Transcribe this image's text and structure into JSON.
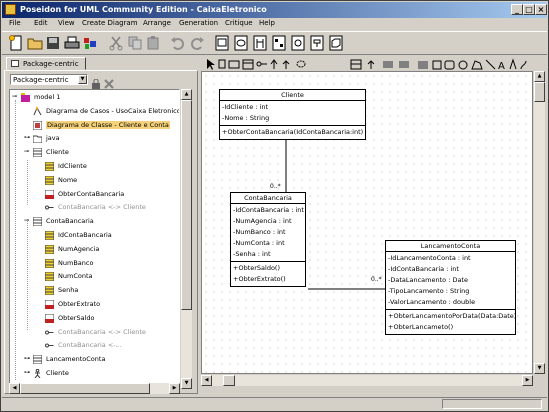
{
  "window": {
    "title": "Poseidon for UML Community Edition - CaixaEletronico"
  },
  "menu": [
    "File",
    "Edit",
    "View",
    "Create Diagram",
    "Arrange",
    "Generation",
    "Critique",
    "Help"
  ],
  "left_panel": {
    "tab_label": "Package-centric",
    "combo_value": "Package-centric",
    "tree": [
      {
        "label": "model 1",
        "icon": "package-icon",
        "level": 0,
        "expanded": true
      },
      {
        "label": "Diagrama de Casos - UsoCaixa Eletronico",
        "icon": "usecase-diagram-icon",
        "level": 1
      },
      {
        "label": "Diagrama de Classe - Cliente e Conta",
        "icon": "class-diagram-icon",
        "level": 1,
        "selected": true
      },
      {
        "label": "java",
        "icon": "folder-icon",
        "level": 1,
        "expanded": false
      },
      {
        "label": "Cliente",
        "icon": "class-icon",
        "level": 1,
        "expanded": true
      },
      {
        "label": "IdCliente",
        "icon": "attribute-icon",
        "level": 2
      },
      {
        "label": "Nome",
        "icon": "attribute-icon",
        "level": 2
      },
      {
        "label": "ObterContaBancaria",
        "icon": "operation-icon",
        "level": 2
      },
      {
        "label": "ContaBancaria <-> Cliente",
        "icon": "association-icon",
        "level": 2,
        "dim": true
      },
      {
        "label": "ContaBancaria",
        "icon": "class-icon",
        "level": 1,
        "expanded": true
      },
      {
        "label": "IdContaBancaria",
        "icon": "attribute-icon",
        "level": 2
      },
      {
        "label": "NumAgencia",
        "icon": "attribute-icon",
        "level": 2
      },
      {
        "label": "NumBanco",
        "icon": "attribute-icon",
        "level": 2
      },
      {
        "label": "NumConta",
        "icon": "attribute-icon",
        "level": 2
      },
      {
        "label": "Senha",
        "icon": "attribute-icon",
        "level": 2
      },
      {
        "label": "ObterExtrato",
        "icon": "operation-icon",
        "level": 2
      },
      {
        "label": "ObterSaldo",
        "icon": "operation-icon",
        "level": 2
      },
      {
        "label": "ContaBancaria <-> Cliente",
        "icon": "association-icon",
        "level": 2,
        "dim": true
      },
      {
        "label": "ContaBancaria <-...",
        "icon": "association-icon",
        "level": 2,
        "dim": true
      },
      {
        "label": "LancamentoConta",
        "icon": "class-icon",
        "level": 1,
        "expanded": false
      },
      {
        "label": "Cliente",
        "icon": "actor-icon",
        "level": 1,
        "expanded": false
      }
    ]
  },
  "diagram": {
    "classes": [
      {
        "name": "Cliente",
        "attributes": [
          "-IdCliente : int",
          "-Nome : String"
        ],
        "operations": [
          "+ObterContaBancaria(IdContaBancaria:int)"
        ]
      },
      {
        "name": "ContaBancaria",
        "attributes": [
          "-IdContaBancaria : int",
          "-NumAgencia : int",
          "-NumBanco : int",
          "-NumConta : int",
          "-Senha : int"
        ],
        "operations": [
          "+ObterSaldo()",
          "+ObterExtrato()"
        ]
      },
      {
        "name": "LancamentoConta",
        "attributes": [
          "-IdLancamentoConta : int",
          "-IdContaBancaria : int",
          "-DataLancamento : Date",
          "-TipoLancamento : String",
          "-ValorLancamento : double"
        ],
        "operations": [
          "+ObterLancamentoPorData(Data:Date)",
          "+ObterLancameto()"
        ]
      }
    ],
    "multiplicities": [
      "0..*",
      "0..*"
    ]
  }
}
